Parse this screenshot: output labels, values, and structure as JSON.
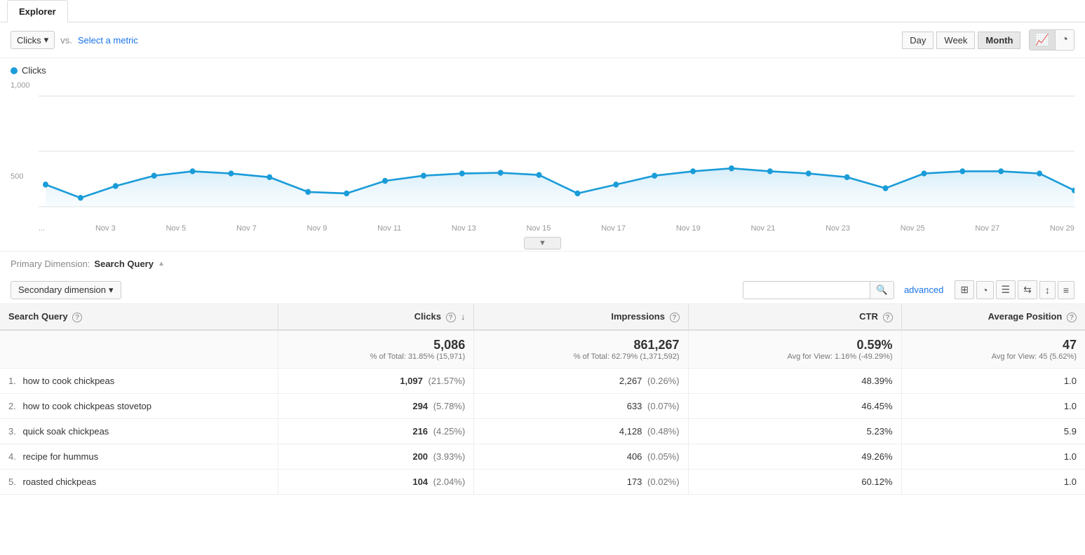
{
  "tab": {
    "label": "Explorer"
  },
  "topControls": {
    "metricDropdown": "Clicks",
    "vsLabel": "vs.",
    "selectMetric": "Select a metric",
    "timeButtons": [
      "Day",
      "Week",
      "Month"
    ],
    "activeTime": "Month",
    "chartTypeButtons": [
      "line",
      "pie"
    ]
  },
  "chart": {
    "legend": "Clicks",
    "legendColor": "#1a9cd8",
    "yLabels": [
      "1,000",
      "500"
    ],
    "xLabels": [
      "...",
      "Nov 3",
      "Nov 5",
      "Nov 7",
      "Nov 9",
      "Nov 11",
      "Nov 13",
      "Nov 15",
      "Nov 17",
      "Nov 19",
      "Nov 21",
      "Nov 23",
      "Nov 25",
      "Nov 27",
      "Nov 29"
    ]
  },
  "dimension": {
    "label": "Primary Dimension:",
    "value": "Search Query"
  },
  "tableControls": {
    "secondaryDim": "Secondary dimension",
    "searchPlaceholder": "",
    "advancedLink": "advanced",
    "viewButtons": [
      "grid",
      "pie",
      "list",
      "arrows-in",
      "arrows-out",
      "table-detail"
    ]
  },
  "table": {
    "columns": [
      {
        "key": "query",
        "label": "Search Query",
        "hasHelp": true
      },
      {
        "key": "clicks",
        "label": "Clicks",
        "hasHelp": true,
        "sortActive": true
      },
      {
        "key": "impressions",
        "label": "Impressions",
        "hasHelp": true
      },
      {
        "key": "ctr",
        "label": "CTR",
        "hasHelp": true
      },
      {
        "key": "avgPosition",
        "label": "Average Position",
        "hasHelp": true
      }
    ],
    "totals": {
      "clicks": "5,086",
      "clicksSub": "% of Total: 31.85% (15,971)",
      "impressions": "861,267",
      "impressionsSub": "% of Total: 62.79% (1,371,592)",
      "ctr": "0.59%",
      "ctrSub": "Avg for View: 1.16% (-49.29%)",
      "avgPosition": "47",
      "avgPositionSub": "Avg for View: 45 (5.62%)"
    },
    "rows": [
      {
        "num": 1,
        "query": "how to cook chickpeas",
        "clicks": "1,097",
        "clicksPct": "(21.57%)",
        "impressions": "2,267",
        "impressionsPct": "(0.26%)",
        "ctr": "48.39%",
        "avgPosition": "1.0"
      },
      {
        "num": 2,
        "query": "how to cook chickpeas stovetop",
        "clicks": "294",
        "clicksPct": "(5.78%)",
        "impressions": "633",
        "impressionsPct": "(0.07%)",
        "ctr": "46.45%",
        "avgPosition": "1.0"
      },
      {
        "num": 3,
        "query": "quick soak chickpeas",
        "clicks": "216",
        "clicksPct": "(4.25%)",
        "impressions": "4,128",
        "impressionsPct": "(0.48%)",
        "ctr": "5.23%",
        "avgPosition": "5.9"
      },
      {
        "num": 4,
        "query": "recipe for hummus",
        "clicks": "200",
        "clicksPct": "(3.93%)",
        "impressions": "406",
        "impressionsPct": "(0.05%)",
        "ctr": "49.26%",
        "avgPosition": "1.0"
      },
      {
        "num": 5,
        "query": "roasted chickpeas",
        "clicks": "104",
        "clicksPct": "(2.04%)",
        "impressions": "173",
        "impressionsPct": "(0.02%)",
        "ctr": "60.12%",
        "avgPosition": "1.0"
      }
    ]
  }
}
